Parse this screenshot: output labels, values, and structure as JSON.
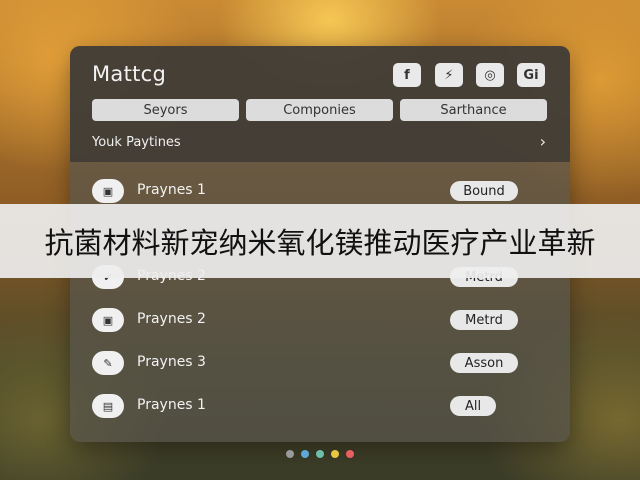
{
  "header": {
    "title": "Mattcg",
    "social_icons": [
      {
        "name": "facebook-icon",
        "glyph": "f"
      },
      {
        "name": "bolt-icon",
        "glyph": "⚡"
      },
      {
        "name": "instagram-icon",
        "glyph": "◎"
      },
      {
        "name": "gi-icon",
        "glyph": "Gi"
      }
    ]
  },
  "tabs": [
    {
      "label": "Seyors"
    },
    {
      "label": "Componies"
    },
    {
      "label": "Sarthance"
    }
  ],
  "section": {
    "title": "Youk Paytines",
    "chevron": "›"
  },
  "list": {
    "items": [
      {
        "icon": "doc-icon",
        "glyph": "▣",
        "label": "Praynes 1",
        "badge": "Bound"
      },
      {
        "icon": "hidden-icon",
        "glyph": "",
        "label": "",
        "badge": ""
      },
      {
        "icon": "check-icon",
        "glyph": "✔",
        "label": "Praynes 2",
        "badge": "Metrd"
      },
      {
        "icon": "doc-icon",
        "glyph": "▣",
        "label": "Praynes 2",
        "badge": "Metrd"
      },
      {
        "icon": "pen-icon",
        "glyph": "✎",
        "label": "Praynes 3",
        "badge": "Asson"
      },
      {
        "icon": "doc-icon",
        "glyph": "▤",
        "label": "Praynes 1",
        "badge": "All"
      }
    ]
  },
  "banner": {
    "text": "抗菌材料新宠纳米氧化镁推动医疗产业革新"
  },
  "pager": {
    "dot_colors": [
      "#9a9a9a",
      "#5fa8d8",
      "#6cc0a8",
      "#e8c840",
      "#e86060"
    ]
  }
}
